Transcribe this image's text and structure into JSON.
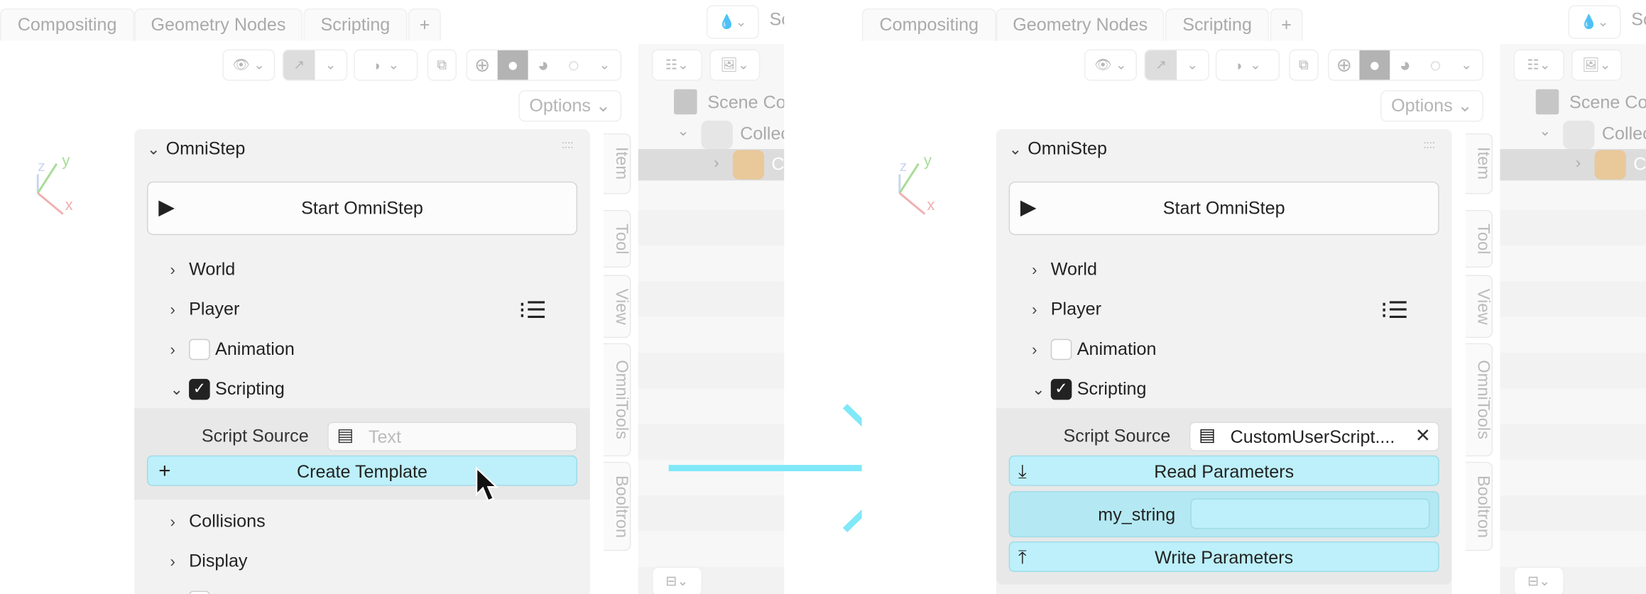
{
  "workspace_tabs": [
    "Compositing",
    "Geometry Nodes",
    "Scripting"
  ],
  "add_tab_label": "+",
  "scene_label": "Sc",
  "options_label": "Options",
  "outliner_rows": [
    "Scene Co",
    "Collec",
    "C"
  ],
  "side_tabs": [
    "Item",
    "Tool",
    "View",
    "OmniTools",
    "Booltron"
  ],
  "gizmo": {
    "x": "x",
    "y": "y",
    "z": "z"
  },
  "panel_title": "OmniStep",
  "start_button": "Start OmniStep",
  "sections": [
    "World",
    "Player",
    "Animation",
    "Scripting"
  ],
  "sections_after": [
    "Collisions",
    "Display"
  ],
  "checkboxes": {
    "animation": false,
    "scripting": true
  },
  "before": {
    "script_source_label": "Script Source",
    "script_placeholder": "Text",
    "create_template": "Create Template"
  },
  "after": {
    "script_source_label": "Script Source",
    "script_value": "CustomUserScript....",
    "read_parameters": "Read Parameters",
    "param_label": "my_string",
    "param_value": "",
    "write_parameters": "Write Parameters"
  },
  "icons": [
    "eye-icon",
    "curve-icon",
    "overlay-icon",
    "xray-icon",
    "wireframe-icon",
    "solid-icon",
    "material-icon",
    "rendered-icon",
    "text-icon",
    "clear-icon",
    "import-icon",
    "export-icon",
    "list-icon",
    "play-icon"
  ],
  "colors": {
    "accent": "#bdf0fa",
    "arrow": "#80e8f8",
    "panel": "#f2f2f2"
  }
}
